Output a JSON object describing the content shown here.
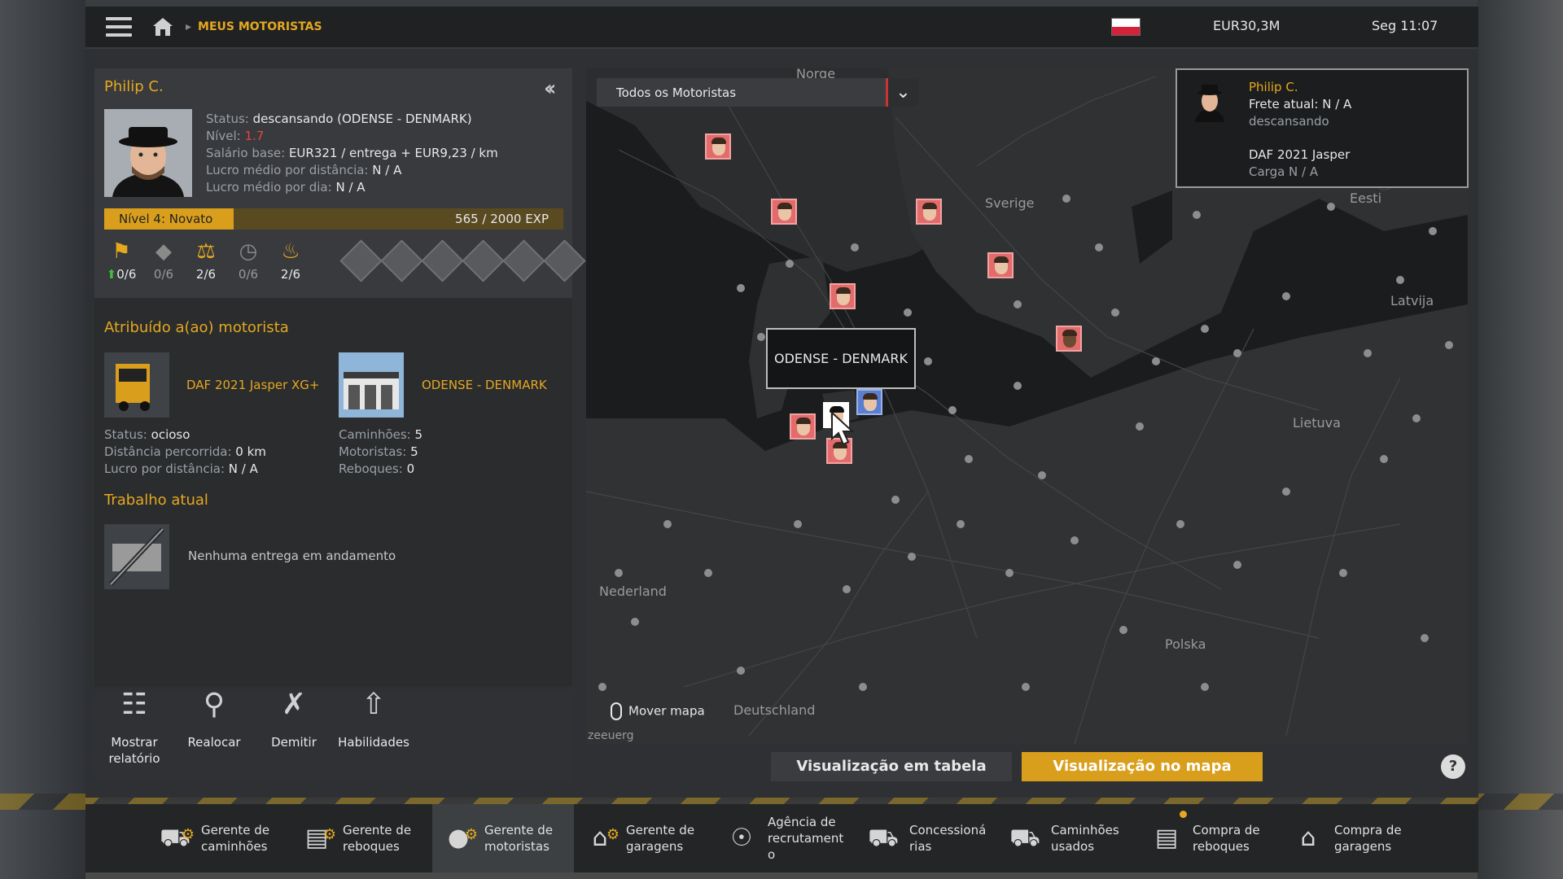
{
  "topbar": {
    "breadcrumb": "MEUS MOTORISTAS",
    "money": "EUR30,3M",
    "clock": "Seg 11:07"
  },
  "driver": {
    "name": "Philip C.",
    "status_label": "Status:",
    "status_value": "descansando (ODENSE - DENMARK)",
    "level_label": "Nível:",
    "level_value": "1.7",
    "salary_label": "Salário base:",
    "salary_value": "EUR321 / entrega + EUR9,23 / km",
    "avg_dist_label": "Lucro médio por distância:",
    "avg_dist_value": "N / A",
    "avg_day_label": "Lucro médio por dia:",
    "avg_day_value": "N / A",
    "level_bar_label": "Nível 4: Novato",
    "exp_text": "565 / 2000 EXP",
    "exp_progress": 0.2825,
    "skills": [
      {
        "icon": "distance-skill-icon",
        "value": "0/6",
        "upgrade": true
      },
      {
        "icon": "hazardous-cargo-skill-icon",
        "value": "0/6"
      },
      {
        "icon": "valuable-cargo-skill-icon",
        "value": "2/6"
      },
      {
        "icon": "urgent-delivery-skill-icon",
        "value": "0/6"
      },
      {
        "icon": "fuel-economy-skill-icon",
        "value": "2/6"
      }
    ]
  },
  "assigned": {
    "title": "Atribuído a(ao) motorista",
    "truck_name": "DAF 2021 Jasper XG+",
    "garage_name": "ODENSE - DENMARK",
    "truck_status_label": "Status:",
    "truck_status_value": "ocioso",
    "truck_dist_label": "Distância percorrida:",
    "truck_dist_value": "0 km",
    "truck_profit_label": "Lucro por distância:",
    "truck_profit_value": "N / A",
    "garage_trucks_label": "Caminhões:",
    "garage_trucks_value": "5",
    "garage_drivers_label": "Motoristas:",
    "garage_drivers_value": "5",
    "garage_trailers_label": "Reboques:",
    "garage_trailers_value": "0"
  },
  "current_job": {
    "title": "Trabalho atual",
    "empty_text": "Nenhuma entrega em andamento"
  },
  "actions": [
    {
      "label": "Mostrar relatório"
    },
    {
      "label": "Realocar"
    },
    {
      "label": "Demitir"
    },
    {
      "label": "Habilidades"
    }
  ],
  "map": {
    "driver_filter": "Todos os Motoristas",
    "countries": {
      "norge": "Norge",
      "sverige": "Sverige",
      "eesti": "Eesti",
      "latvija": "Latvija",
      "lietuva": "Lietuva",
      "nederland": "Nederland",
      "deutschland": "Deutschland",
      "polska": "Polska",
      "zeeland": "zeeuerg"
    },
    "tooltip": "ODENSE - DENMARK",
    "move_hint": "Mover mapa"
  },
  "infocard": {
    "name": "Philip C.",
    "job": "Frete atual: N / A",
    "state": "descansando",
    "truck": "DAF 2021 Jasper",
    "cargo": "Carga N / A"
  },
  "view_buttons": {
    "table": "Visualização em tabela",
    "map": "Visualização no mapa"
  },
  "bottom_nav": [
    {
      "line1": "Gerente de",
      "line2": "caminhões"
    },
    {
      "line1": "Gerente de",
      "line2": "reboques"
    },
    {
      "line1": "Gerente de",
      "line2": "motoristas"
    },
    {
      "line1": "Gerente de",
      "line2": "garagens"
    },
    {
      "line1": "Agência de",
      "line2": "recrutament",
      "line3": "o"
    },
    {
      "line1": "Concessioná",
      "line2": "rias"
    },
    {
      "line1": "Caminhões",
      "line2": "usados"
    },
    {
      "line1": "Compra de",
      "line2": "reboques"
    },
    {
      "line1": "Compra de",
      "line2": "garagens"
    }
  ],
  "colors": {
    "accent": "#e5a81f",
    "level_value": "#e34545",
    "upgrade_arrow": "#3fbf3f",
    "pin_red": "#e46b6b",
    "pin_blue": "#5a7ed0"
  }
}
